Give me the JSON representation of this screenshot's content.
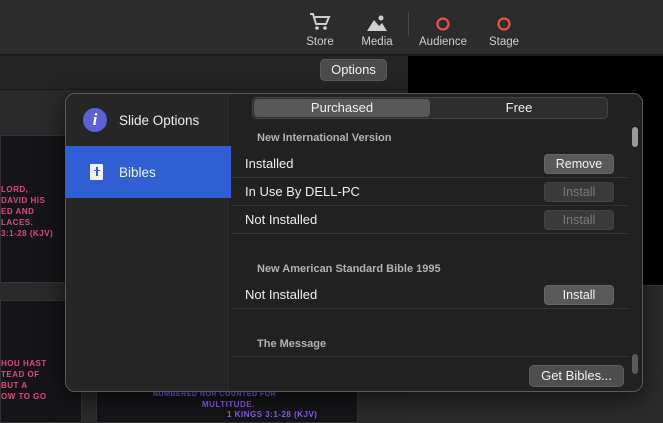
{
  "toolbar": {
    "items": [
      {
        "label": "Store",
        "icon": "cart-icon"
      },
      {
        "label": "Media",
        "icon": "photo-icon"
      },
      {
        "label": "Audience",
        "icon": "circle-icon"
      },
      {
        "label": "Stage",
        "icon": "circle-icon"
      }
    ],
    "accent": "#e8554a"
  },
  "options_button": "Options",
  "background_slides": {
    "slide1": [
      "LORD,",
      "DAVID HIS",
      "ED AND",
      "LACES.",
      "3:1-28 (KJV)"
    ],
    "slide2": [
      "HOU HAST",
      "TEAD OF",
      "BUT A",
      "OW TO GO"
    ],
    "slide3": [
      "NUMBERED NOR COUNTED FOR",
      "MULTITUDE.",
      "1 KINGS 3:1-28 (KJV)"
    ]
  },
  "popover": {
    "sidebar": [
      {
        "label": "Slide Options",
        "icon": "info-icon",
        "active": false
      },
      {
        "label": "Bibles",
        "icon": "bible-icon",
        "active": true
      }
    ],
    "tabs": [
      {
        "label": "Purchased",
        "selected": true
      },
      {
        "label": "Free",
        "selected": false
      }
    ],
    "sections": [
      {
        "title": "New International Version",
        "rows": [
          {
            "name": "Installed",
            "button": "Remove",
            "enabled": true
          },
          {
            "name": "In Use By DELL-PC",
            "button": "Install",
            "enabled": false
          },
          {
            "name": "Not Installed",
            "button": "Install",
            "enabled": false
          }
        ]
      },
      {
        "title": "New American Standard Bible 1995",
        "rows": [
          {
            "name": "Not Installed",
            "button": "Install",
            "enabled": true
          }
        ]
      },
      {
        "title": "The Message",
        "rows": []
      }
    ],
    "get_bibles": "Get Bibles..."
  },
  "colors": {
    "selection": "#2f5fd3"
  }
}
